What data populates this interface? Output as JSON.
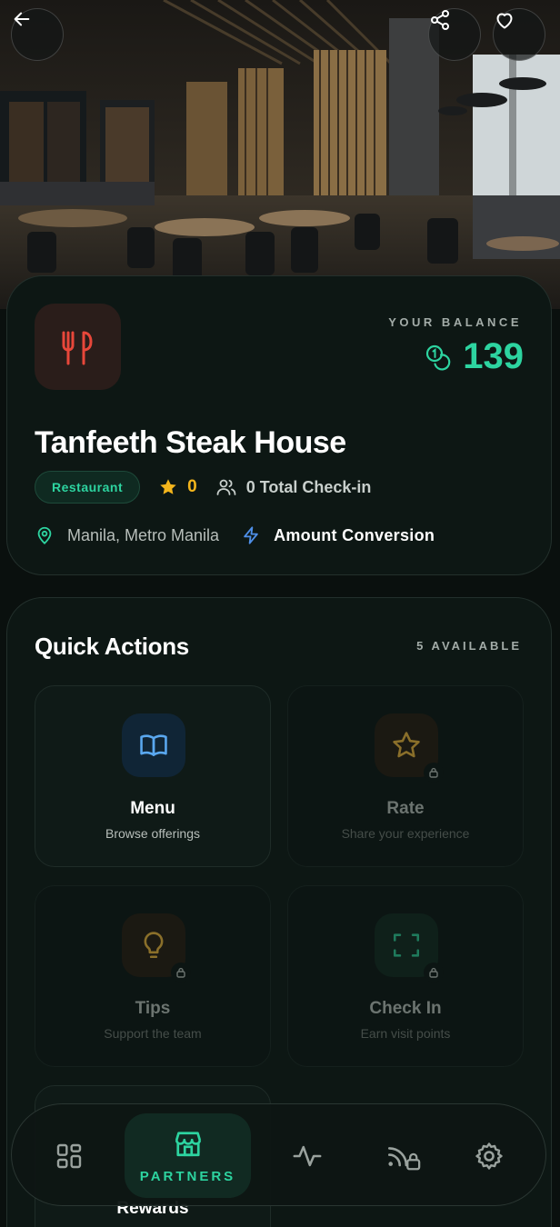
{
  "hero": {
    "back_label": "back",
    "share_label": "share",
    "favorite_label": "favorite"
  },
  "venue": {
    "name": "Tanfeeth Steak House",
    "category": "Restaurant",
    "rating": "0",
    "checkins": "0 Total Check-in",
    "location": "Manila, Metro Manila",
    "conversion": "Amount Conversion",
    "logo_icon": "utensils-icon"
  },
  "balance": {
    "label": "YOUR BALANCE",
    "value": "139"
  },
  "quick_actions": {
    "title": "Quick Actions",
    "count": "5 AVAILABLE",
    "items": [
      {
        "title": "Menu",
        "subtitle": "Browse offerings",
        "icon": "book-icon",
        "locked": false
      },
      {
        "title": "Rate",
        "subtitle": "Share your experience",
        "icon": "star-icon",
        "locked": true
      },
      {
        "title": "Tips",
        "subtitle": "Support the team",
        "icon": "lightbulb-icon",
        "locked": true
      },
      {
        "title": "Check In",
        "subtitle": "Earn visit points",
        "icon": "scan-icon",
        "locked": true
      },
      {
        "title": "Rewards",
        "subtitle": "",
        "icon": "gift-icon",
        "locked": false
      }
    ]
  },
  "nav": {
    "active_label": "PARTNERS",
    "items": [
      "dashboard-icon",
      "store-icon",
      "activity-icon",
      "nfc-lock-icon",
      "gear-icon"
    ]
  },
  "colors": {
    "accent": "#2dd4a0",
    "star": "#f3b51c",
    "card_bg": "#0d1714",
    "logo_red": "#e8473a"
  }
}
